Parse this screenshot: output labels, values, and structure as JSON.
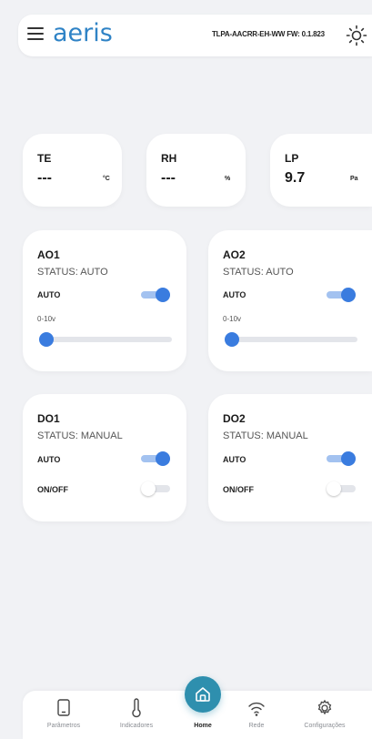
{
  "header": {
    "logo": "aeris",
    "device_info": "TLPA-AACRR-EH-WW FW: 0.1.823"
  },
  "sensors": [
    {
      "label": "TE",
      "value": "---",
      "unit": "°C"
    },
    {
      "label": "RH",
      "value": "---",
      "unit": "%"
    },
    {
      "label": "LP",
      "value": "9.7",
      "unit": "Pa"
    }
  ],
  "analog_outputs": [
    {
      "title": "AO1",
      "status": "STATUS: AUTO",
      "auto_label": "AUTO",
      "auto_on": true,
      "range_label": "0-10v",
      "slider_value": 0
    },
    {
      "title": "AO2",
      "status": "STATUS: AUTO",
      "auto_label": "AUTO",
      "auto_on": true,
      "range_label": "0-10v",
      "slider_value": 0
    }
  ],
  "digital_outputs": [
    {
      "title": "DO1",
      "status": "STATUS: MANUAL",
      "auto_label": "AUTO",
      "auto_on": true,
      "onoff_label": "ON/OFF",
      "onoff_on": false
    },
    {
      "title": "DO2",
      "status": "STATUS: MANUAL",
      "auto_label": "AUTO",
      "auto_on": true,
      "onoff_label": "ON/OFF",
      "onoff_on": false
    }
  ],
  "nav": {
    "items": [
      {
        "label": "Parâmetros",
        "icon": "tablet-icon"
      },
      {
        "label": "Indicadores",
        "icon": "thermometer-icon"
      },
      {
        "label": "Home",
        "icon": "home-icon",
        "active": true
      },
      {
        "label": "Rede",
        "icon": "wifi-icon"
      },
      {
        "label": "Configurações",
        "icon": "gear-icon"
      }
    ]
  },
  "colors": {
    "accent": "#3a7cdf",
    "logo": "#2f83c6",
    "home_fab": "#2e8fae",
    "background": "#f1f2f5"
  }
}
